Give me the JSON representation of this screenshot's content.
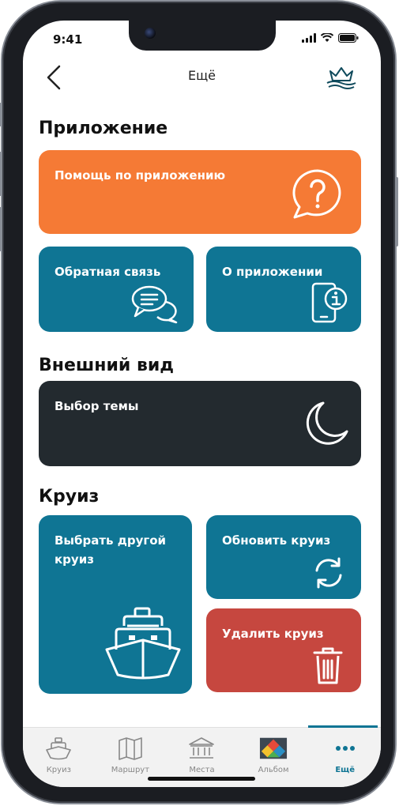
{
  "status_bar": {
    "time": "9:41"
  },
  "header": {
    "title": "Ещё"
  },
  "sections": {
    "app": {
      "title": "Приложение",
      "help": "Помощь по приложению",
      "feedback": "Обратная связь",
      "about": "О приложении"
    },
    "appearance": {
      "title": "Внешний вид",
      "theme": "Выбор темы"
    },
    "cruise": {
      "title": "Круиз",
      "choose_other": "Выбрать другой круиз",
      "update": "Обновить круиз",
      "delete": "Удалить круиз"
    }
  },
  "bottom_nav": {
    "items": [
      {
        "label": "Круиз",
        "icon": "ship-icon"
      },
      {
        "label": "Маршрут",
        "icon": "map-icon"
      },
      {
        "label": "Места",
        "icon": "museum-icon"
      },
      {
        "label": "Альбом",
        "icon": "album-icon"
      },
      {
        "label": "Ещё",
        "icon": "more-icon",
        "active": true
      }
    ]
  },
  "colors": {
    "orange": "#f57a35",
    "blue": "#0f7594",
    "dark": "#232a2f",
    "red": "#c6473f"
  }
}
